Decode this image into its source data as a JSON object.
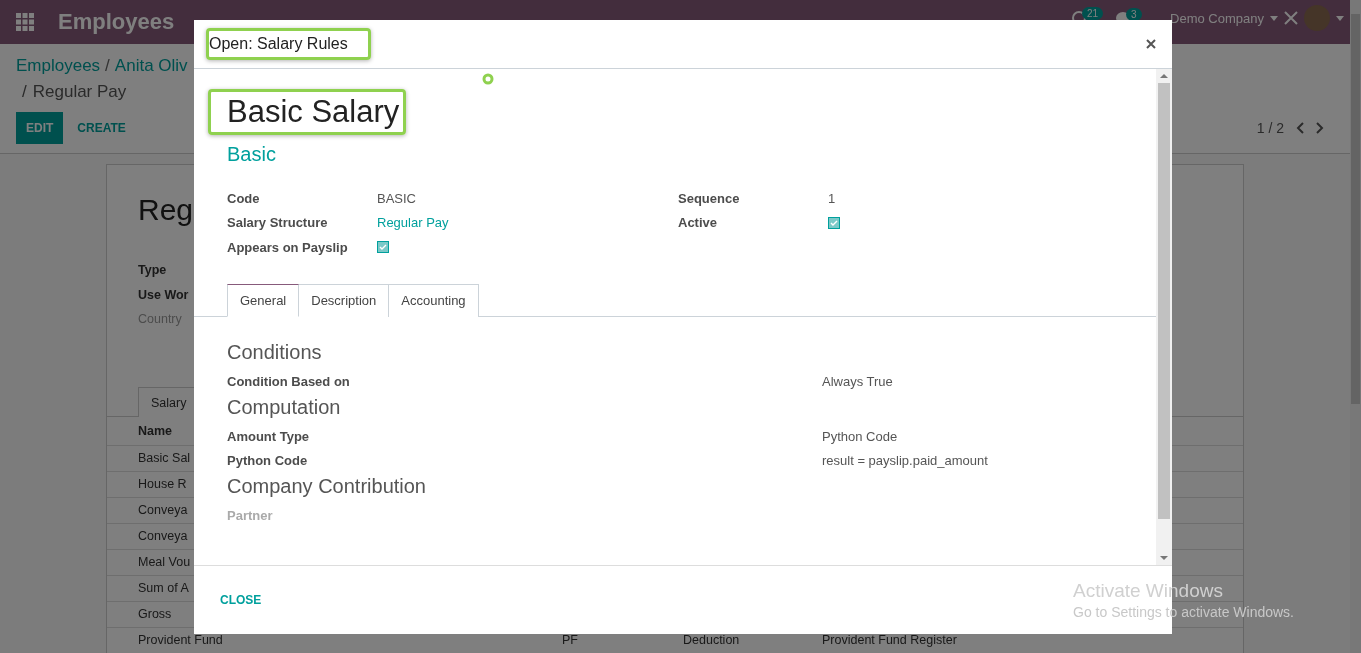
{
  "navbar": {
    "app_title": "Employees",
    "activity_count": "21",
    "message_count": "3",
    "company": "Demo Company"
  },
  "breadcrumb": {
    "items": [
      "Employees",
      "Anita Oliv"
    ],
    "separator": "/",
    "current": "Regular Pay"
  },
  "actions": [
    "EDIT",
    "CREATE"
  ],
  "pager": "1 / 2",
  "background_form": {
    "title": "Reg",
    "fields": [
      {
        "label": "Type",
        "muted": false
      },
      {
        "label": "Use Wor",
        "muted": false
      },
      {
        "label": "Country",
        "muted": true
      }
    ],
    "tab": "Salary",
    "columns": [
      "Name"
    ],
    "rows": [
      {
        "cells": [
          "Basic Sal"
        ]
      },
      {
        "cells": [
          "House R"
        ]
      },
      {
        "cells": [
          "Conveya"
        ]
      },
      {
        "cells": [
          "Conveya"
        ]
      },
      {
        "cells": [
          "Meal Vou"
        ]
      },
      {
        "cells": [
          "Sum of A"
        ]
      },
      {
        "cells": [
          "Gross"
        ]
      },
      {
        "cells": [
          "Provident Fund",
          "PF",
          "Deduction",
          "Provident Fund Register"
        ]
      }
    ]
  },
  "dialog": {
    "title": "Open: Salary Rules",
    "title_highlighted": true,
    "name": "Basic Salary",
    "name_highlighted": true,
    "category": "Basic",
    "fields_left": [
      {
        "label": "Code",
        "kind": "text",
        "value": "BASIC"
      },
      {
        "label": "Salary Structure",
        "kind": "link",
        "value": "Regular Pay"
      },
      {
        "label": "Appears on Payslip",
        "kind": "checkbox",
        "checked": true
      }
    ],
    "fields_right": [
      {
        "label": "Sequence",
        "kind": "text",
        "value": "1"
      },
      {
        "label": "Active",
        "kind": "checkbox",
        "checked": true
      }
    ],
    "tabs": [
      {
        "label": "General",
        "selected": true
      },
      {
        "label": "Description",
        "selected": false
      },
      {
        "label": "Accounting",
        "selected": false
      }
    ],
    "sections": [
      {
        "title": "Conditions",
        "fields": [
          {
            "label": "Condition Based on",
            "value": "Always True",
            "muted": false
          }
        ]
      },
      {
        "title": "Computation",
        "fields": [
          {
            "label": "Amount Type",
            "value": "Python Code",
            "muted": false
          },
          {
            "label": "Python Code",
            "value": "result = payslip.paid_amount",
            "muted": false
          }
        ]
      },
      {
        "title": "Company Contribution",
        "fields": [
          {
            "label": "Partner",
            "muted": true
          }
        ]
      }
    ],
    "close_button": "CLOSE"
  },
  "os_notice": {
    "title": "Activate Windows",
    "subtitle": "Go to Settings to activate Windows."
  }
}
